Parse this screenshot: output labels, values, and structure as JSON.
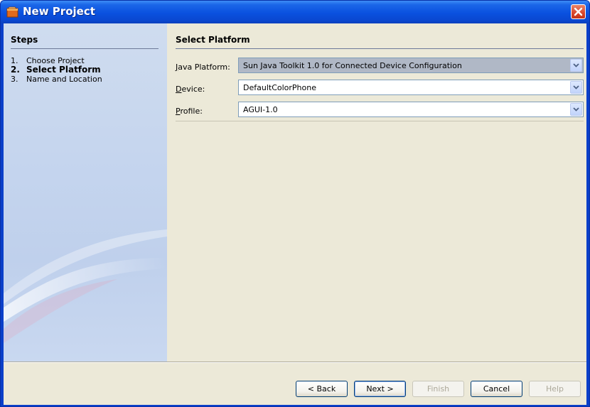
{
  "window": {
    "title": "New Project"
  },
  "steps": {
    "heading": "Steps",
    "items": [
      {
        "number": "1.",
        "label": "Choose Project",
        "current": false
      },
      {
        "number": "2.",
        "label": "Select Platform",
        "current": true
      },
      {
        "number": "3.",
        "label": "Name and Location",
        "current": false
      }
    ]
  },
  "main": {
    "heading": "Select Platform",
    "fields": [
      {
        "label": "Java Platform:",
        "mnemonic": "J",
        "value": "Sun Java Toolkit 1.0 for Connected Device Configuration"
      },
      {
        "label": "Device:",
        "mnemonic": "D",
        "value": "DefaultColorPhone"
      },
      {
        "label": "Profile:",
        "mnemonic": "P",
        "value": "AGUI-1.0"
      }
    ]
  },
  "buttons": {
    "back": "< Back",
    "next": "Next >",
    "finish": "Finish",
    "cancel": "Cancel",
    "help": "Help"
  },
  "colors": {
    "title_bar": "#0a51df",
    "close_button": "#d9452a",
    "steps_panel": "#c5d5ee",
    "dialog_body": "#ece9d8"
  },
  "icons": {
    "window": "project-icon",
    "close": "close-icon",
    "dropdown": "chevron-down-icon"
  }
}
